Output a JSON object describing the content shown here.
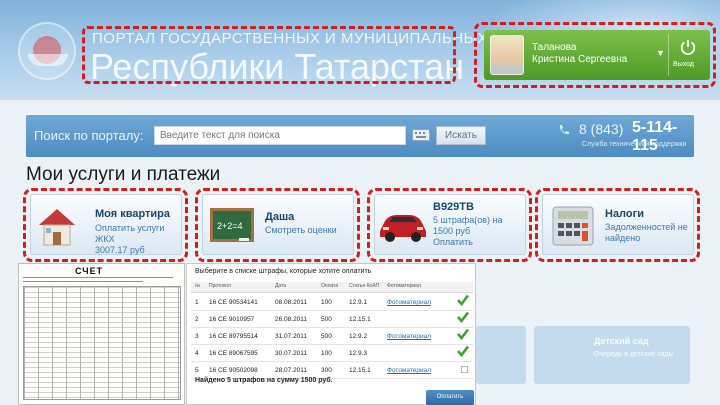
{
  "header": {
    "portal_title": "ПОРТАЛ ГОСУДАРСТВЕННЫХ И МУНИЦИПАЛЬНЫХ УСЛУГ",
    "portal_subtitle": "Республики Татарстан"
  },
  "user": {
    "last_name": "Таланова",
    "first_name": "Кристина Сергеевна",
    "logout_label": "Выход"
  },
  "search": {
    "label": "Поиск по порталу:",
    "placeholder": "Введите текст для поиска",
    "button_label": "Искать",
    "phone_code": "8 (843)",
    "phone_number": "5-114-115",
    "phone_caption": "Служба технической поддержки"
  },
  "section_title": "Мои услуги и платежи",
  "cards": [
    {
      "title": "Моя квартира",
      "desc1": "Оплатить услуги ЖКХ",
      "desc2": "3007.17 руб",
      "desc3": "",
      "icon": "house-icon"
    },
    {
      "title": "Даша",
      "desc1": "Смотреть оценки",
      "desc2": "",
      "desc3": "",
      "icon": "chalkboard-icon"
    },
    {
      "title": "В929ТВ",
      "desc1": "5 штрафа(ов) на",
      "desc2": "1500 руб",
      "desc3": "Оплатить",
      "icon": "car-icon"
    },
    {
      "title": "Налоги",
      "desc1": "Задолженностей не",
      "desc2": "найдено",
      "desc3": "",
      "icon": "calculator-icon"
    }
  ],
  "document": {
    "title": "СЧЕТ"
  },
  "fines": {
    "heading": "Выберите в списке штрафы, которые хотите оплатить",
    "columns": [
      "№",
      "Протокол",
      "Дата",
      "Оплата",
      "Статья КоАП",
      "Фотоматериал"
    ],
    "rows": [
      {
        "n": "1",
        "protocol": "16 СЕ 90534141",
        "date": "08.08.2011",
        "sum": "100",
        "article": "12.9.1",
        "photo": "Фотоматериал",
        "checked": true
      },
      {
        "n": "2",
        "protocol": "16 СЕ 9010957",
        "date": "26.08.2011",
        "sum": "500",
        "article": "12.15.1",
        "photo": "",
        "checked": true
      },
      {
        "n": "3",
        "protocol": "16 СЕ 89795514",
        "date": "31.07.2011",
        "sum": "500",
        "article": "12.9.2",
        "photo": "Фотоматериал",
        "checked": true
      },
      {
        "n": "4",
        "protocol": "16 СЕ 89067595",
        "date": "30.07.2011",
        "sum": "100",
        "article": "12.9.3",
        "photo": "",
        "checked": true
      },
      {
        "n": "5",
        "protocol": "16 СЕ 90502098",
        "date": "28.07.2011",
        "sum": "300",
        "article": "12.15.1",
        "photo": "Фотоматериал",
        "checked": false
      }
    ],
    "total": "Найдено 5 штрафов на сумму 1500 руб.",
    "pay_label": "Оплатить"
  },
  "faded": {
    "card1_title": "Детский сад",
    "card1_desc": "Очередь в детские сады"
  },
  "colors": {
    "dash_red": "#d41e1e",
    "user_green": "#5aa833",
    "search_blue": "#5a96c8",
    "card_title": "#16476e"
  }
}
